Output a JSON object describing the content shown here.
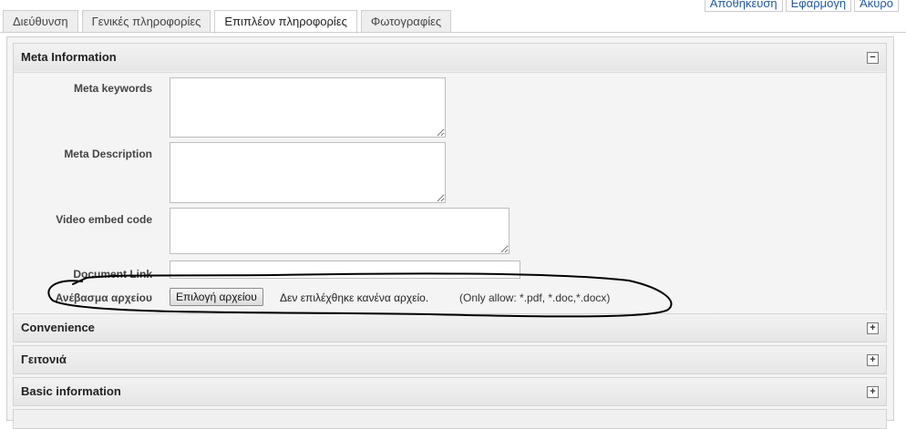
{
  "actions": [
    "Αποθήκευση",
    "Εφαρμογή",
    "Άκυρο"
  ],
  "tabs": [
    {
      "label": "Διεύθυνση",
      "active": false
    },
    {
      "label": "Γενικές πληροφορίες",
      "active": false
    },
    {
      "label": "Επιπλέον πληροφορίες",
      "active": true
    },
    {
      "label": "Φωτογραφίες",
      "active": false
    }
  ],
  "meta": {
    "title": "Meta Information",
    "toggle": "−",
    "keywords_label": "Meta keywords",
    "keywords_value": "",
    "description_label": "Meta Description",
    "description_value": "",
    "video_label": "Video embed code",
    "video_value": "",
    "doclink_label": "Document Link",
    "doclink_value": "",
    "upload_label": "Ανέβασμα αρχείου",
    "upload_button": "Επιλογή αρχείου",
    "upload_status": "Δεν επιλέχθηκε κανένα αρχείο.",
    "upload_allow": "(Only allow: *.pdf, *.doc,*.docx)"
  },
  "sections": [
    {
      "title": "Convenience",
      "toggle": "+"
    },
    {
      "title": "Γειτονιά",
      "toggle": "+"
    },
    {
      "title": "Basic information",
      "toggle": "+"
    }
  ],
  "annotation": {
    "color": "#000000",
    "shape": "hand-drawn ellipse"
  }
}
